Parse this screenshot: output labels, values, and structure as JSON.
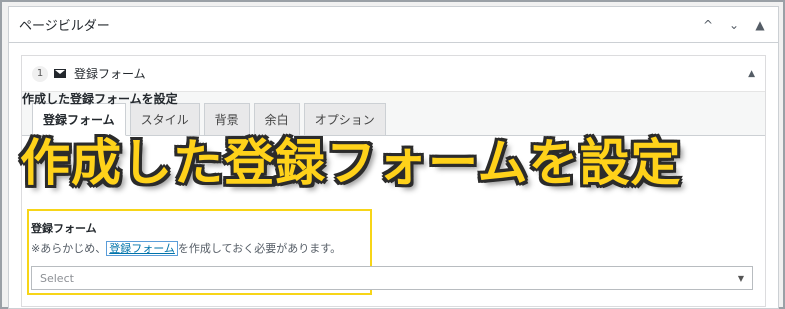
{
  "postbox": {
    "title": "ページビルダー",
    "controls": [
      "^",
      "⌄",
      "▲"
    ]
  },
  "module": {
    "number": "1",
    "title": "登録フォーム",
    "toggle": "▲"
  },
  "tabs": [
    {
      "label": "登録フォーム",
      "active": true
    },
    {
      "label": "スタイル",
      "active": false
    },
    {
      "label": "背景",
      "active": false
    },
    {
      "label": "余白",
      "active": false
    },
    {
      "label": "オプション",
      "active": false
    }
  ],
  "behind_row": "作成した登録フォームを設定",
  "overlay": {
    "title": "作成した登録フォームを設定"
  },
  "field": {
    "label": "登録フォーム",
    "desc_prefix": "※あらかじめ、",
    "desc_link": "登録フォーム",
    "desc_suffix": "を作成しておく必要があります。",
    "select_value": "Select",
    "select_arrow": "▼"
  },
  "colors": {
    "accent_overlay": "#ffd21a",
    "highlight_border": "#f7d518",
    "link": "#0073aa"
  },
  "icons": {
    "module_icon": "envelope-icon"
  }
}
